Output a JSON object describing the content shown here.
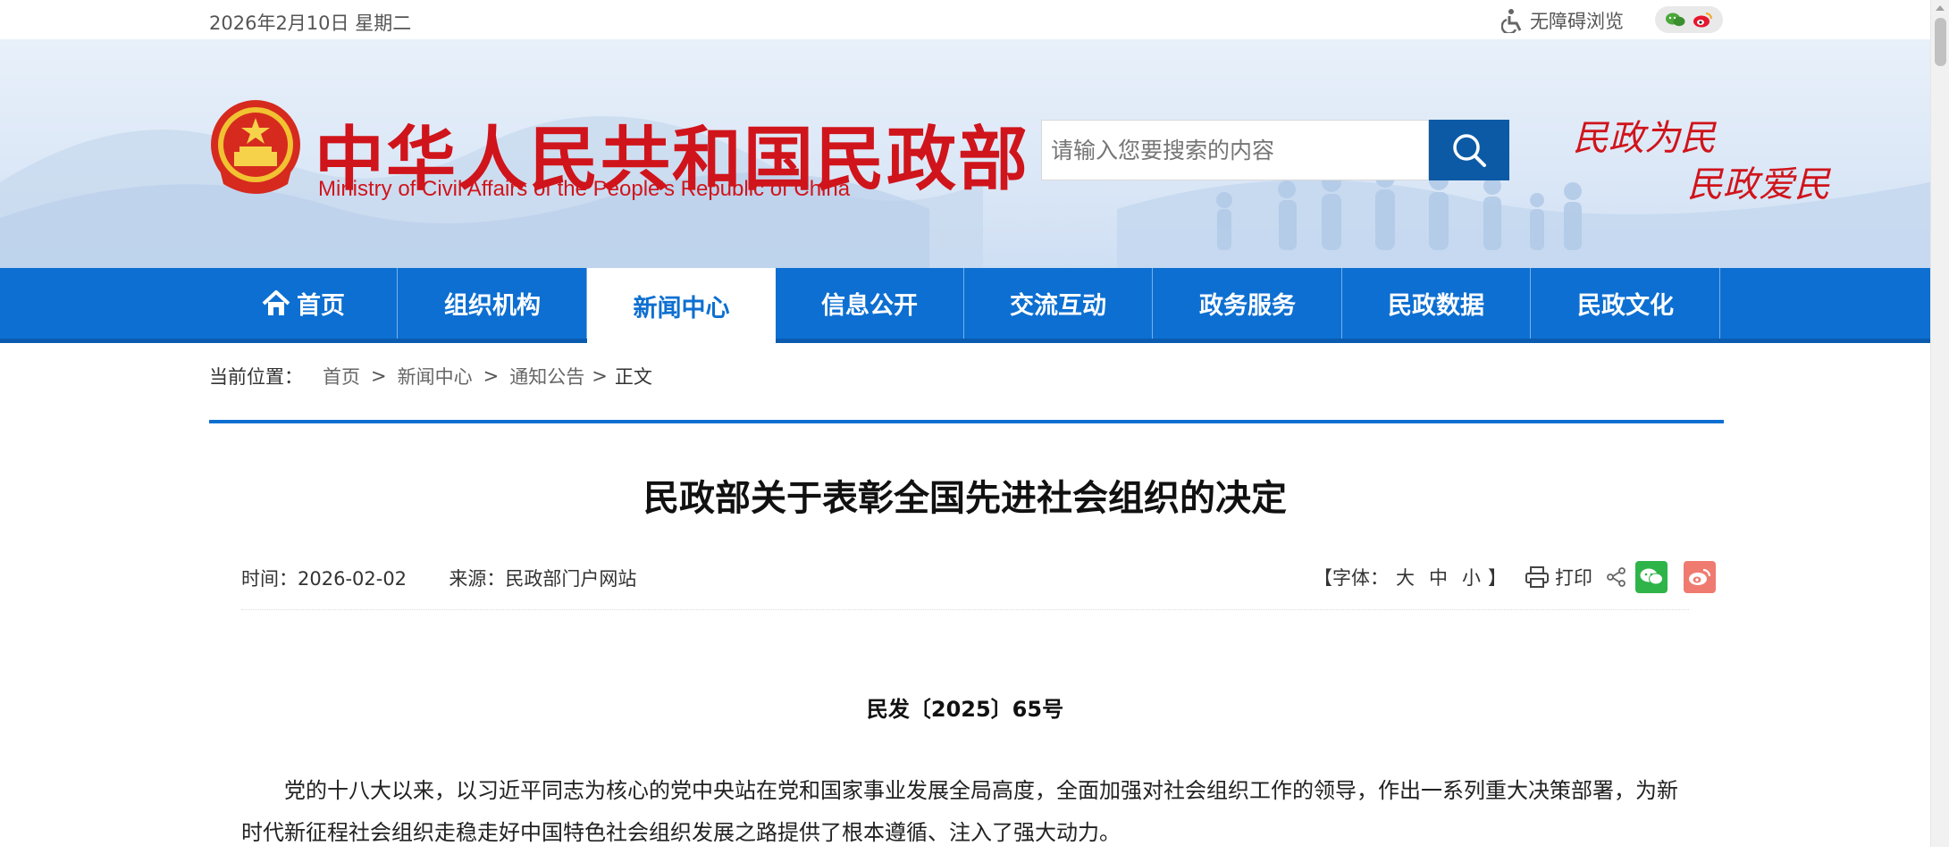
{
  "topbar": {
    "date": "2026年2月10日 星期二",
    "accessibility_label": "无障碍浏览"
  },
  "header": {
    "title_cn": "中华人民共和国民政部",
    "title_en": "Ministry of Civil Affairs of the People's Republic of China",
    "search_placeholder": "请输入您要搜索的内容",
    "slogan_line1": "民政为民",
    "slogan_line2": "民政爱民"
  },
  "nav": {
    "items": [
      {
        "label": "首页"
      },
      {
        "label": "组织机构"
      },
      {
        "label": "新闻中心"
      },
      {
        "label": "信息公开"
      },
      {
        "label": "交流互动"
      },
      {
        "label": "政务服务"
      },
      {
        "label": "民政数据"
      },
      {
        "label": "民政文化"
      }
    ],
    "active_index": 2
  },
  "breadcrumb": {
    "label": "当前位置：",
    "items": [
      "首页",
      "新闻中心",
      "通知公告",
      "正文"
    ],
    "separator": ">"
  },
  "article": {
    "title": "民政部关于表彰全国先进社会组织的决定",
    "time_label": "时间：",
    "time_value": "2026-02-02",
    "source_label": "来源：",
    "source_value": "民政部门户网站",
    "font_prefix": "【字体：",
    "font_large": "大",
    "font_medium": "中",
    "font_small": "小",
    "font_suffix": "】",
    "print_label": "打印",
    "doc_number": "民发〔2025〕65号",
    "paragraph1": "党的十八大以来，以习近平同志为核心的党中央站在党和国家事业发展全局高度，全面加强对社会组织工作的领导，作出一系列重大决策部署，为新时代新征程社会组织走稳走好中国特色社会组织发展之路提供了根本遵循、注入了强大动力。"
  },
  "colors": {
    "brand_red": "#d0141b",
    "nav_blue": "#0d6fd1",
    "search_blue": "#0c5aa5",
    "wechat_green": "#2fb44a",
    "weibo_red": "#ef7b70"
  }
}
